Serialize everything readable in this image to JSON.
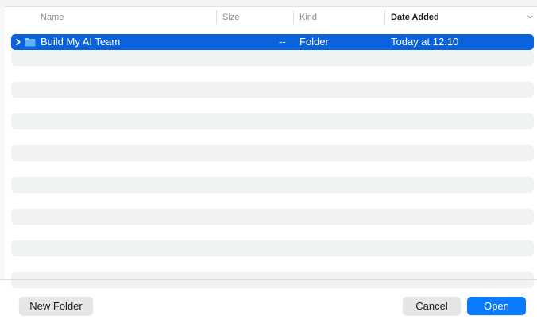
{
  "columns": {
    "name": "Name",
    "size": "Size",
    "kind": "Kind",
    "date_added": "Date Added"
  },
  "sort": {
    "column": "Date Added",
    "direction": "descending",
    "indicator_icon": "chevron-down-icon"
  },
  "rows": [
    {
      "name": "Build My AI Team",
      "size": "--",
      "kind": "Folder",
      "date_added": "Today at 12:10",
      "icon": "folder-icon",
      "selected": true,
      "expandable": true
    }
  ],
  "footer": {
    "new_folder_label": "New Folder",
    "cancel_label": "Cancel",
    "open_label": "Open"
  },
  "colors": {
    "selection": "#0a63dc",
    "primary_button": "#0a7bff",
    "stripe": "#f1f2f2",
    "folder_icon": "#5cb2f0"
  }
}
